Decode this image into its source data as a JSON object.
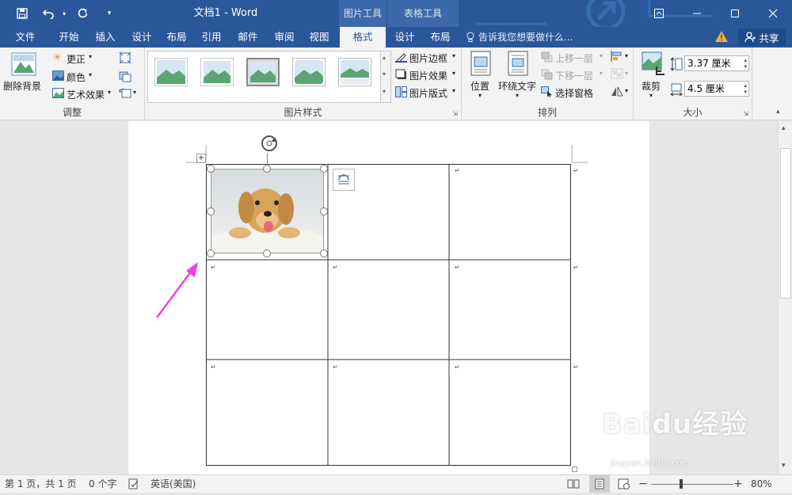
{
  "window": {
    "title": "文档1 - Word",
    "context_groups": {
      "picture_tools": "图片工具",
      "table_tools": "表格工具"
    }
  },
  "tabs": [
    {
      "label": "文件"
    },
    {
      "label": "开始"
    },
    {
      "label": "插入"
    },
    {
      "label": "设计"
    },
    {
      "label": "布局"
    },
    {
      "label": "引用"
    },
    {
      "label": "邮件"
    },
    {
      "label": "审阅"
    },
    {
      "label": "视图"
    },
    {
      "label": "格式"
    },
    {
      "label": "设计"
    },
    {
      "label": "布局"
    }
  ],
  "tell_me": "告诉我您想要做什么...",
  "share": "共享",
  "ribbon": {
    "adjust": {
      "label": "调整",
      "remove_bg": "删除背景",
      "corrections": "更正",
      "color": "颜色",
      "artistic": "艺术效果"
    },
    "styles": {
      "label": "图片样式",
      "border": "图片边框",
      "effects": "图片效果",
      "layout": "图片版式"
    },
    "arrange": {
      "label": "排列",
      "position": "位置",
      "wrap": "环绕文字",
      "bring_forward": "上移一层",
      "send_backward": "下移一层",
      "selection_pane": "选择窗格"
    },
    "size": {
      "label": "大小",
      "crop": "裁剪",
      "height": "3.37 厘米",
      "width": "4.5 厘米"
    }
  },
  "status": {
    "page": "第 1 页，共 1 页",
    "words": "0 个字",
    "language": "英语(美国)",
    "zoom": "80%"
  },
  "watermark": {
    "brand": "Baidu经验",
    "url": "jingyan.baidu.com"
  },
  "colors": {
    "accent": "#2b579a",
    "arrow": "#ee3ee8"
  }
}
